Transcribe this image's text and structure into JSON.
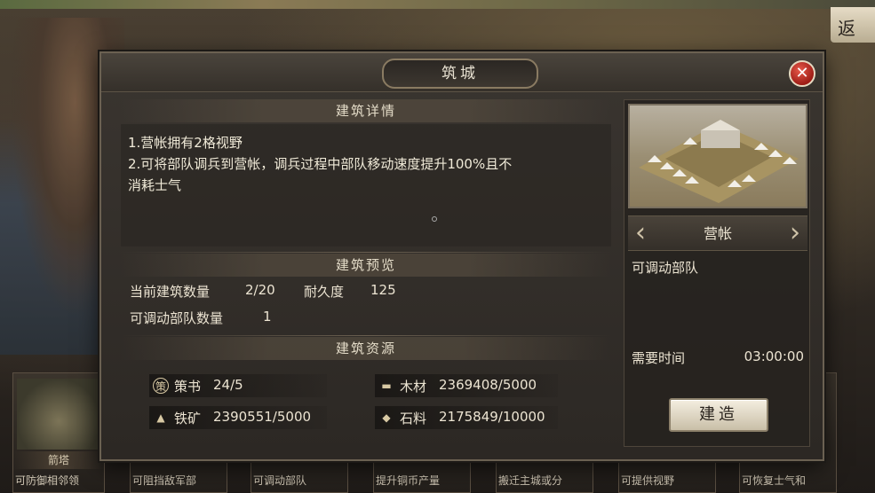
{
  "background": {
    "back_label": "返",
    "bottom_cards": [
      {
        "name": "箭塔",
        "desc": "可防御相邻领"
      },
      {
        "name": "",
        "desc": "可阻挡敌军部"
      },
      {
        "name": "",
        "desc": "可调动部队"
      },
      {
        "name": "",
        "desc": "提升铜币产量"
      },
      {
        "name": "",
        "desc": "搬迁主城或分"
      },
      {
        "name": "",
        "desc": "可提供视野"
      },
      {
        "name": "",
        "desc": "可恢复士气和"
      }
    ]
  },
  "dialog": {
    "title": "筑城",
    "close_icon": "close-icon",
    "details": {
      "section_title": "建筑详情",
      "lines": [
        "1.营帐拥有2格视野",
        "2.可将部队调兵到营帐，调兵过程中部队移动速度提升100%且不",
        "消耗士气"
      ]
    },
    "preview": {
      "section_title": "建筑预览",
      "current_count_label": "当前建筑数量",
      "current_count_value": "2/20",
      "durability_label": "耐久度",
      "durability_value": "125",
      "deployable_label": "可调动部队数量",
      "deployable_value": "1"
    },
    "resources": {
      "section_title": "建筑资源",
      "items": [
        {
          "icon": "policy-book-icon",
          "name": "策书",
          "value": "24/5"
        },
        {
          "icon": "wood-icon",
          "name": "木材",
          "value": "2369408/5000"
        },
        {
          "icon": "iron-ore-icon",
          "name": "铁矿",
          "value": "2390551/5000"
        },
        {
          "icon": "stone-icon",
          "name": "石料",
          "value": "2175849/10000"
        }
      ]
    },
    "building": {
      "name": "营帐",
      "ability": "可调动部队",
      "time_label": "需要时间",
      "time_value": "03:00:00",
      "build_label": "建造"
    }
  }
}
